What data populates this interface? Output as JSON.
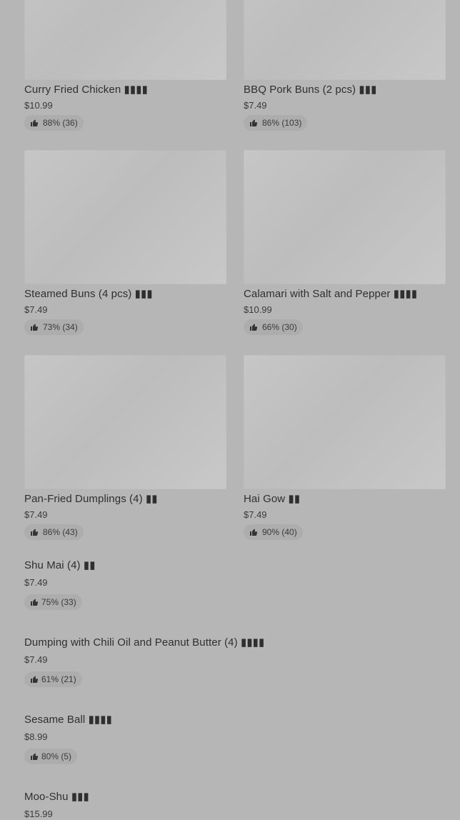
{
  "grid": [
    {
      "name": "Curry Fried Chicken ▮▮▮▮",
      "price": "$10.99",
      "rating": "88% (36)"
    },
    {
      "name": "BBQ Pork Buns (2 pcs) ▮▮▮",
      "price": "$7.49",
      "rating": "86% (103)"
    },
    {
      "name": "Steamed Buns (4 pcs) ▮▮▮",
      "price": "$7.49",
      "rating": "73% (34)"
    },
    {
      "name": "Calamari with Salt and Pepper ▮▮▮▮",
      "price": "$10.99",
      "rating": "66% (30)"
    },
    {
      "name": "Pan-Fried Dumplings (4) ▮▮",
      "price": "$7.49",
      "rating": "86% (43)"
    },
    {
      "name": "Hai Gow ▮▮",
      "price": "$7.49",
      "rating": "90% (40)"
    }
  ],
  "list": [
    {
      "name": "Shu Mai (4) ▮▮",
      "price": "$7.49",
      "rating": "75% (33)"
    },
    {
      "name": "Dumping with Chili Oil and Peanut Butter (4) ▮▮▮▮",
      "price": "$7.49",
      "rating": "61% (21)"
    },
    {
      "name": "Sesame Ball ▮▮▮▮",
      "price": "$8.99",
      "rating": "80% (5)"
    },
    {
      "name": "Moo-Shu ▮▮▮",
      "price": "$15.99",
      "rating": ""
    }
  ],
  "icons": {
    "rating": "thumbs-up-icon"
  }
}
